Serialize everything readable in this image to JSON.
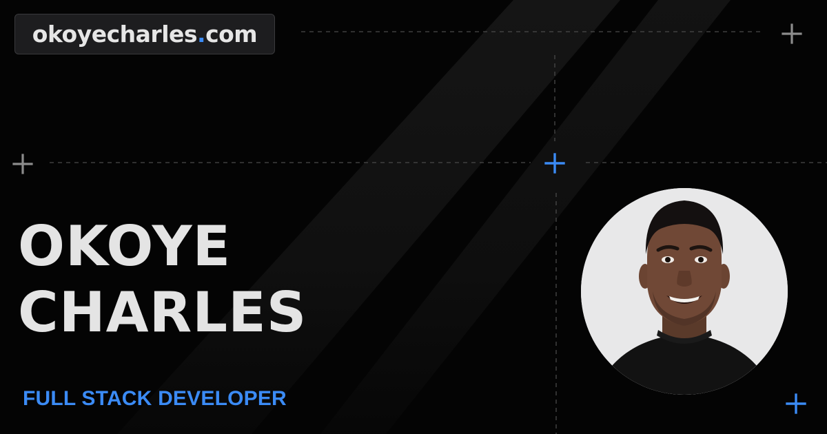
{
  "site": {
    "domain_name": "okoyecharles",
    "domain_dot": ".",
    "domain_tld": "com"
  },
  "profile": {
    "first_name": "OKOYE",
    "last_name": "CHARLES",
    "role": "FULL STACK DEVELOPER"
  },
  "colors": {
    "background": "#040404",
    "accent": "#3b8bf5",
    "text": "#e4e4e4",
    "muted": "#8a8a8a"
  },
  "icons": [
    "plus-icon"
  ]
}
